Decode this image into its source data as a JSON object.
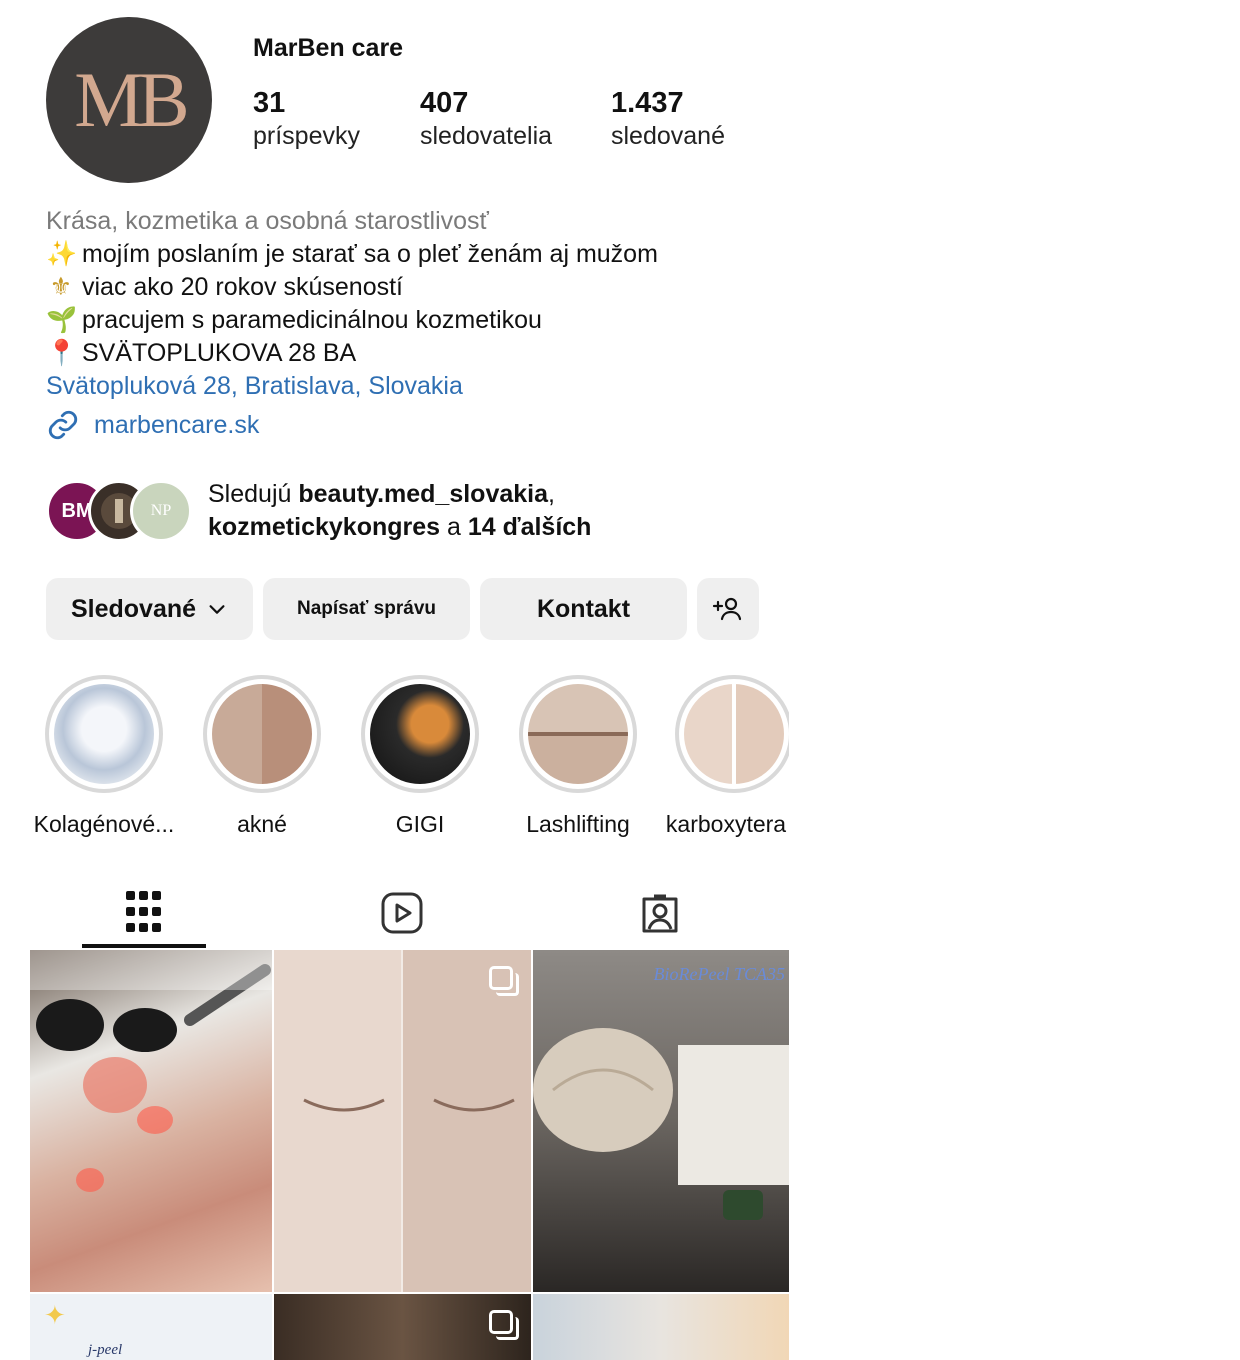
{
  "profile": {
    "avatar_monogram": "MB",
    "name": "MarBen care",
    "stats": {
      "posts": {
        "value": "31",
        "label": "príspevky"
      },
      "followers": {
        "value": "407",
        "label": "sledovatelia"
      },
      "following": {
        "value": "1.437",
        "label": "sledované"
      }
    }
  },
  "bio": {
    "category": "Krása, kozmetika a osobná starostlivosť",
    "lines": [
      {
        "emoji": "✨",
        "text": "mojím poslaním je starať sa o pleť ženám aj mužom"
      },
      {
        "emoji": "⚜",
        "text": "viac ako 20 rokov skúseností"
      },
      {
        "emoji": "🌱",
        "text": "pracujem s paramedicinálnou kozmetikou"
      },
      {
        "emoji": "📍",
        "text": "SVÄTOPLUKOVA 28 BA"
      }
    ],
    "address": "Svätopluková 28, Bratislava, Slovakia",
    "website": "marbencare.sk"
  },
  "followed_by": {
    "avatar1_text": "BM",
    "avatar3_text": "NP",
    "prefix": "Sledujú ",
    "user1": "beauty.med_slovakia",
    "separator": ",",
    "user2": "kozmetickykongres",
    "conj": " a ",
    "others": "14 ďalších"
  },
  "buttons": {
    "following": "Sledované",
    "message": "Napísať správu",
    "contact": "Kontakt"
  },
  "highlights": [
    {
      "label": "Kolagénové..."
    },
    {
      "label": "akné"
    },
    {
      "label": "GIGI"
    },
    {
      "label": "Lashlifting"
    },
    {
      "label": "karboxytera"
    }
  ],
  "tabs": {
    "active": "grid-tab",
    "items": [
      "grid-tab",
      "reels-tab",
      "tagged-tab"
    ]
  },
  "posts": [
    {
      "multi": false
    },
    {
      "multi": true
    },
    {
      "multi": false,
      "overlay_text": "BioRePeel TCA35"
    },
    {
      "multi": false,
      "overlay_text": "j-peel"
    },
    {
      "multi": true
    },
    {
      "multi": false
    }
  ],
  "colors": {
    "link": "#2f6fb3",
    "button_bg": "#efefef",
    "avatar_bg": "#3d3b3a",
    "monogram": "#d2a88f"
  }
}
